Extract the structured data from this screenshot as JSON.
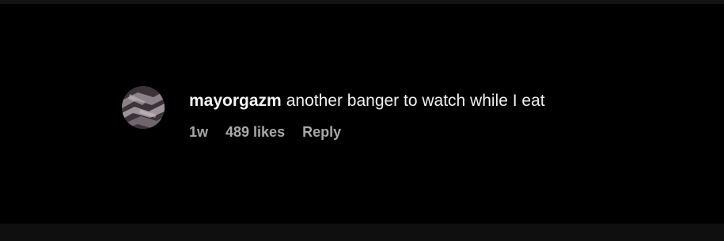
{
  "comment": {
    "username": "mayorgazm",
    "text": "another banger to watch while I eat",
    "time": "1w",
    "likes": "489 likes",
    "reply_label": "Reply",
    "avatar_icon": "user-avatar"
  },
  "colors": {
    "background": "#000000",
    "username": "#f5f5f5",
    "text": "#f0f0f0",
    "meta": "#a8a8a8"
  }
}
